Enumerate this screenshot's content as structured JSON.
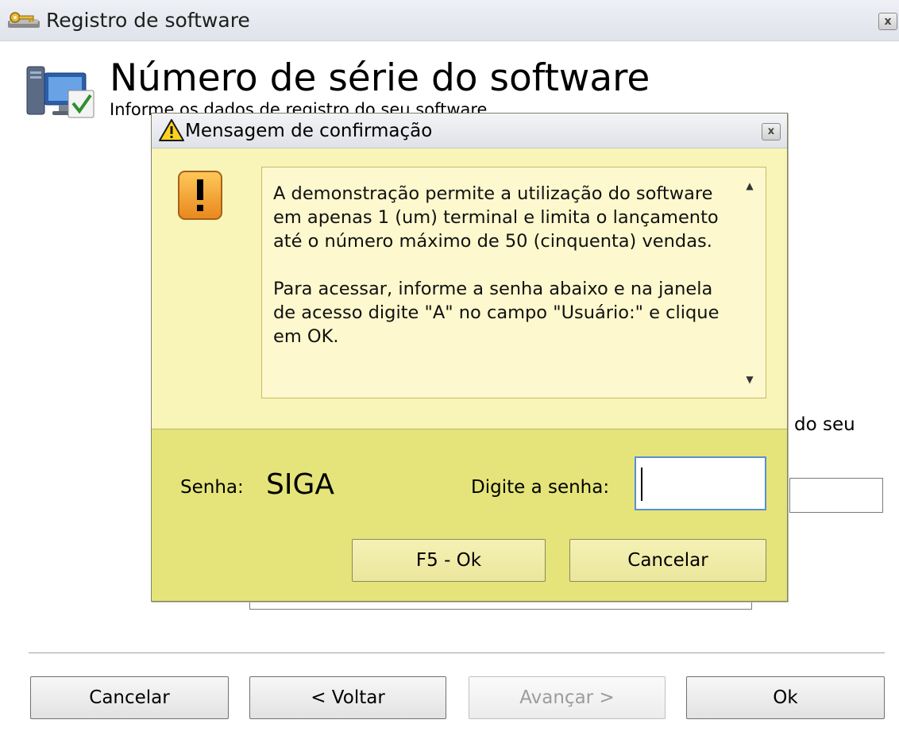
{
  "main_window": {
    "title": "Registro de software",
    "close_glyph": "x",
    "header_title": "Número de série do software",
    "header_subtitle": "Informe os dados de registro do seu software",
    "partial_text": "do seu",
    "footer": {
      "cancel_label": "Cancelar",
      "back_label": "< Voltar",
      "next_label": "Avançar >",
      "ok_label": "Ok"
    }
  },
  "dialog": {
    "title": "Mensagem de confirmação",
    "close_glyph": "x",
    "message": {
      "paragraph1": "A demonstração permite a utilização do software em apenas 1 (um) terminal e limita o lançamento até o número máximo de 50 (cinquenta) vendas.",
      "paragraph2": "Para acessar, informe a senha abaixo e na janela de acesso digite \"A\" no campo \"Usuário:\" e clique em OK."
    },
    "password_caption": "Senha:",
    "password_value": "SIGA",
    "enter_password_label": "Digite a senha:",
    "password_input_value": "",
    "ok_label": "F5 - Ok",
    "cancel_label": "Cancelar"
  },
  "icons": {
    "main_title_icon": "keys-icon",
    "wizard_icon": "computer-check-icon",
    "dialog_title_icon": "warning-icon",
    "message_icon": "exclamation-icon"
  },
  "colors": {
    "dialog_background": "#f8f4b2",
    "dialog_lower_background": "#e5e47a",
    "message_background": "#fdf8cd",
    "input_border": "#5a8fd0"
  }
}
